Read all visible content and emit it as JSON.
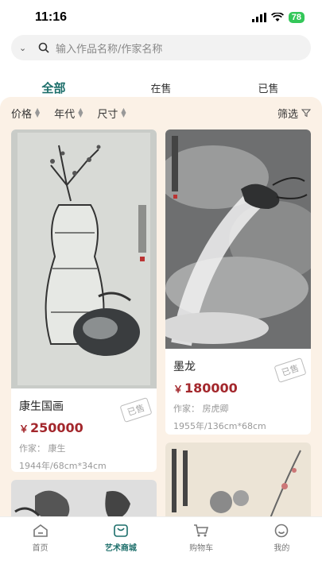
{
  "status": {
    "time": "11:16",
    "battery": "78"
  },
  "search": {
    "placeholder": "输入作品名称/作家名称"
  },
  "tabs": [
    {
      "label": "全部",
      "active": true
    },
    {
      "label": "在售",
      "active": false
    },
    {
      "label": "已售",
      "active": false
    }
  ],
  "filters": {
    "items": [
      "价格",
      "年代",
      "尺寸"
    ],
    "filter_label": "筛选"
  },
  "cards": [
    {
      "name": "康生国画",
      "currency": "￥",
      "price": "250000",
      "artist": "作家：  康生",
      "meta": "1944年/68cm*34cm",
      "stamp": "已售"
    },
    {
      "name": "墨龙",
      "currency": "￥",
      "price": "180000",
      "artist": "作家：  房虎卿",
      "meta": "1955年/136cm*68cm",
      "stamp": "已售"
    }
  ],
  "tabbar": [
    {
      "label": "首页",
      "icon": "home-icon"
    },
    {
      "label": "艺术商城",
      "icon": "mall-icon",
      "active": true
    },
    {
      "label": "购物车",
      "icon": "cart-icon"
    },
    {
      "label": "我的",
      "icon": "profile-icon"
    }
  ],
  "colors": {
    "accent": "#1c6e6a",
    "price": "#a3272c",
    "band": "#fbf1e6"
  }
}
